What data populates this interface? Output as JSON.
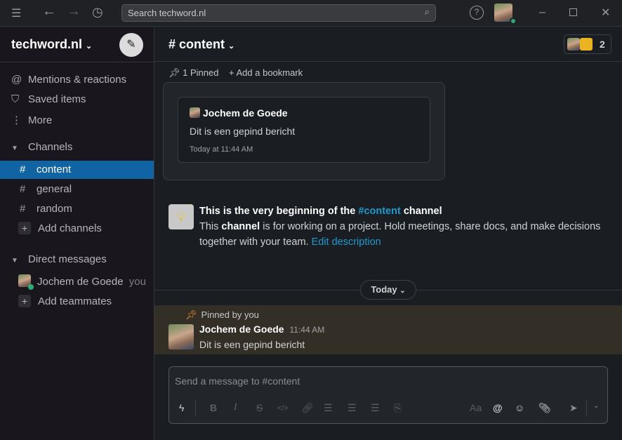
{
  "titlebar": {
    "search_placeholder": "Search techword.nl",
    "icons": [
      "menu-icon",
      "back-arrow-icon",
      "forward-arrow-icon",
      "history-icon",
      "search-icon",
      "help-icon",
      "minimize-icon",
      "maximize-icon",
      "close-icon"
    ]
  },
  "sidebar": {
    "workspace": "techword.nl",
    "nav": [
      {
        "label": "Mentions & reactions",
        "icon": "@"
      },
      {
        "label": "Saved items",
        "icon": "bookmark"
      },
      {
        "label": "More",
        "icon": "more"
      }
    ],
    "channels_header": "Channels",
    "channels": [
      {
        "name": "content",
        "selected": true
      },
      {
        "name": "general"
      },
      {
        "name": "random"
      }
    ],
    "add_channels": "Add channels",
    "dm_header": "Direct messages",
    "dms": [
      {
        "name": "Jochem de Goede",
        "suffix": "you",
        "status": "online"
      }
    ],
    "add_teammates": "Add teammates"
  },
  "header": {
    "channel": "# content",
    "member_count": "2",
    "pinned": "1 Pinned",
    "add_bookmark": "Add a bookmark"
  },
  "pinned_popup": {
    "author": "Jochem de Goede",
    "text": "Dit is een gepind bericht",
    "time": "Today at 11:44 AM"
  },
  "intro": {
    "title_pre": "This is the very beginning of the ",
    "title_link": "#content",
    "title_post": " channel",
    "desc_pre": "This ",
    "desc_bold": "channel",
    "desc_post": " is for working on a project. Hold meetings, share docs, and make decisions together with your team. ",
    "edit": "Edit description"
  },
  "divider": {
    "label": "Today"
  },
  "message": {
    "pinned_by": "Pinned by you",
    "author": "Jochem de Goede",
    "time": "11:44 AM",
    "text": "Dit is een gepind bericht"
  },
  "composer": {
    "placeholder": "Send a message to #content"
  },
  "colors": {
    "accent": "#1164a3",
    "link": "#1d9bd1",
    "pin": "#e8912d",
    "online": "#2bac76"
  }
}
